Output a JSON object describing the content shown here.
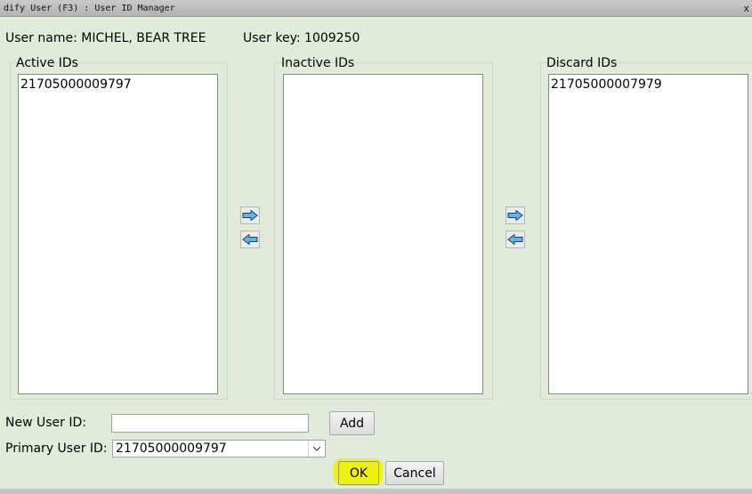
{
  "window": {
    "title": "dify User (F3) : User ID Manager",
    "close_glyph": "x"
  },
  "info": {
    "user_name_label": "User name:",
    "user_name": "MICHEL, BEAR TREE",
    "user_key_label": "User key:",
    "user_key": "1009250"
  },
  "lists": {
    "active": {
      "label": "Active IDs",
      "items": [
        "21705000009797"
      ]
    },
    "inactive": {
      "label": "Inactive IDs",
      "items": []
    },
    "discard": {
      "label": "Discard IDs",
      "items": [
        "21705000007979"
      ]
    }
  },
  "arrows": {
    "color": "#5fb7e8",
    "icons": [
      "arrow-right-icon",
      "arrow-left-icon"
    ]
  },
  "new_user": {
    "label": "New User ID:",
    "value": "",
    "add_label": "Add"
  },
  "primary": {
    "label": "Primary User ID:",
    "selected": "21705000009797"
  },
  "actions": {
    "ok_label": "OK",
    "cancel_label": "Cancel"
  },
  "colors": {
    "background": "#e1ebda",
    "highlight": "#eef20a"
  }
}
